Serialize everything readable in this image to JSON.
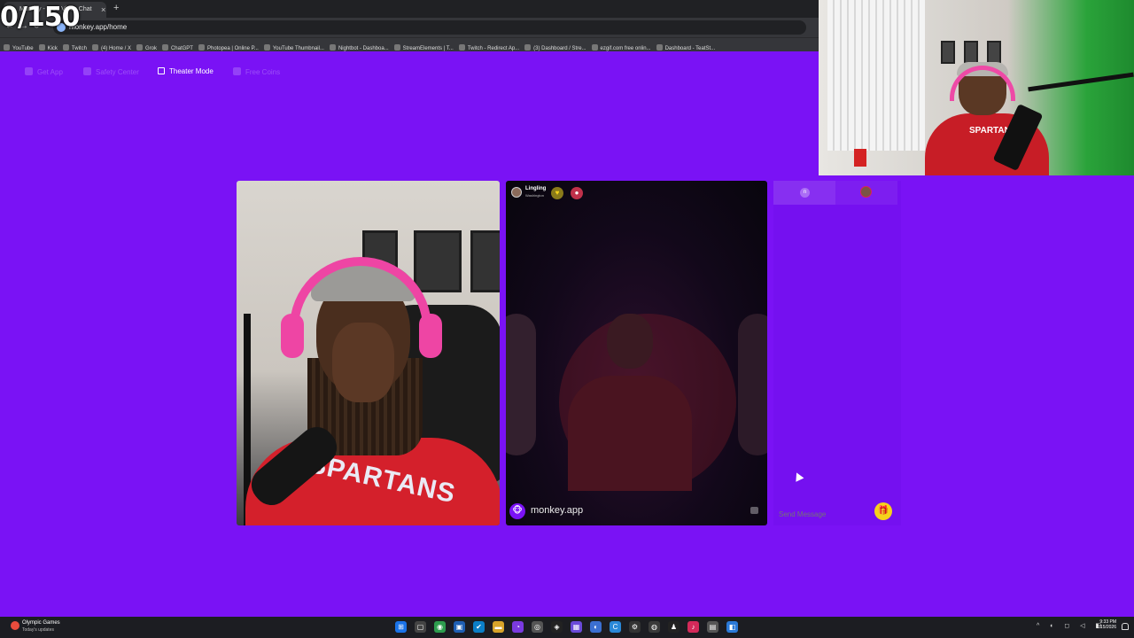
{
  "browser": {
    "active_tab": "Monkey - Free Video Chat",
    "new_tab_symbol": "+",
    "close_symbol": "×",
    "url": "monkey.app/home",
    "bookmarks": [
      "YouTube",
      "Kick",
      "Twitch",
      "(4) Home / X",
      "Grok",
      "ChatGPT",
      "Photopea | Online P...",
      "YouTube Thumbnail...",
      "Nightbot - Dashboa...",
      "StreamElements | T...",
      "Twitch - Redirect Ap...",
      "(3) Dashboard / Stre...",
      "ezgif.com free onlin...",
      "Dashboard - TeatSt..."
    ]
  },
  "overlay": {
    "counter": "0/150"
  },
  "site_nav": {
    "items": [
      {
        "label": "Get App",
        "active": false
      },
      {
        "label": "Safety Center",
        "active": false
      },
      {
        "label": "Theater Mode",
        "active": true
      },
      {
        "label": "Free Coins",
        "active": false
      }
    ]
  },
  "webcam": {
    "shirt_text": "SPARTANS"
  },
  "self_video": {
    "shirt_text": "SPARTANS"
  },
  "peer": {
    "name": "Lingling",
    "location": "Washington"
  },
  "brand": {
    "name": "monkey.app",
    "icon": "🐵"
  },
  "chat": {
    "tab_label": "n",
    "placeholder": "Send Message",
    "gift_icon": "🎁"
  },
  "taskbar": {
    "weather_title": "Olympic Games",
    "weather_sub": "Today's updates",
    "time": "9:33 PM",
    "date": "2/15/2026"
  },
  "colors": {
    "background": "#7a12f5",
    "gift": "#f6d21b",
    "headphones": "#ee45a4",
    "shirt": "#d4202b"
  }
}
